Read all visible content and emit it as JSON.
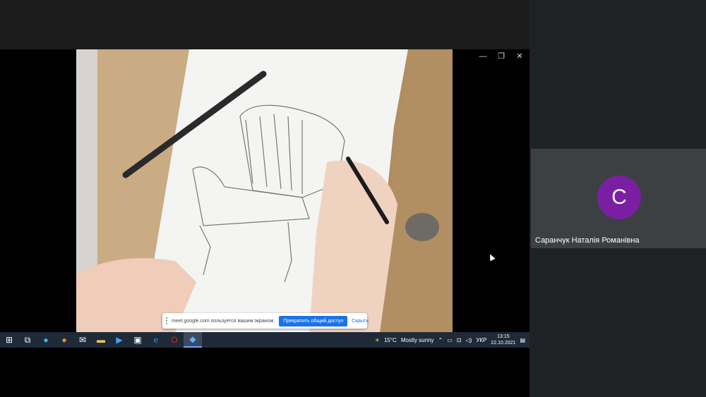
{
  "share_bar": {
    "message": "meet.google.com пользуется вашим экраном.",
    "stop_label": "Прекратить общий доступ",
    "hide_label": "Скрыть"
  },
  "taskbar": {
    "weather": "15°C",
    "weather_text": "Mostly sunny",
    "lang": "УКР",
    "time": "13:15",
    "date": "22.10.2021",
    "apps": [
      "start-icon",
      "task-view-icon",
      "edge-icon",
      "firefox-icon",
      "mail-icon",
      "file-manager-icon",
      "media-player-icon",
      "store-icon",
      "ie-icon",
      "opera-icon",
      "remote-icon"
    ]
  },
  "participant": {
    "initial": "С",
    "name": "Саранчук Наталія Романівна",
    "avatar_color": "#7b1fa2"
  }
}
